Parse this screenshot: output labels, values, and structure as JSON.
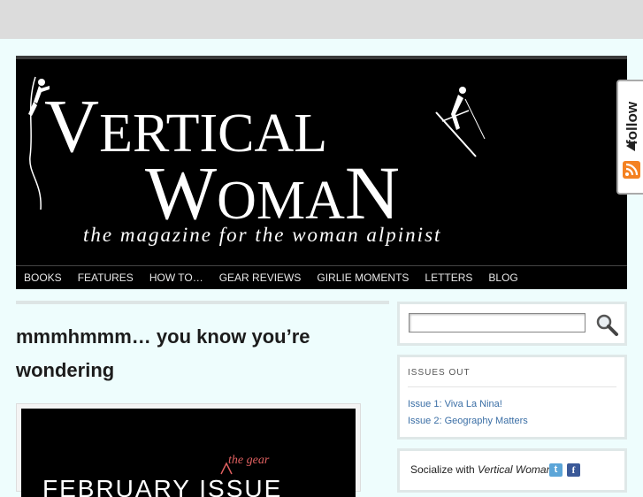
{
  "logo": {
    "line1": "VERTICAL",
    "line2": "WOMAN",
    "tagline": "the magazine for the woman alpinist"
  },
  "nav": {
    "items": [
      "BOOKS",
      "FEATURES",
      "HOW TO…",
      "GEAR REVIEWS",
      "GIRLIE MOMENTS",
      "LETTERS",
      "BLOG"
    ]
  },
  "post": {
    "title": "mmmhmmm… you know you’re wondering",
    "image_text_main": "FEBRUARY ISSUE",
    "image_text_insert": "the gear"
  },
  "search": {
    "value": "",
    "icon": "search-icon"
  },
  "issues": {
    "heading": "ISSUES OUT",
    "items": [
      "Issue 1: Viva La Nina!",
      "Issue 2: Geography Matters"
    ]
  },
  "social": {
    "prefix": "Socialize with ",
    "brand": "Vertical Woman",
    "suffix": " :",
    "twitter_icon": "t",
    "facebook_icon": "f"
  },
  "follow": {
    "label": "follow",
    "rss_icon": "rss-icon"
  },
  "colors": {
    "page_bg": "#eefdfd",
    "banner_bg": "#000000",
    "link": "#3a6ea5",
    "rss": "#f48222"
  }
}
